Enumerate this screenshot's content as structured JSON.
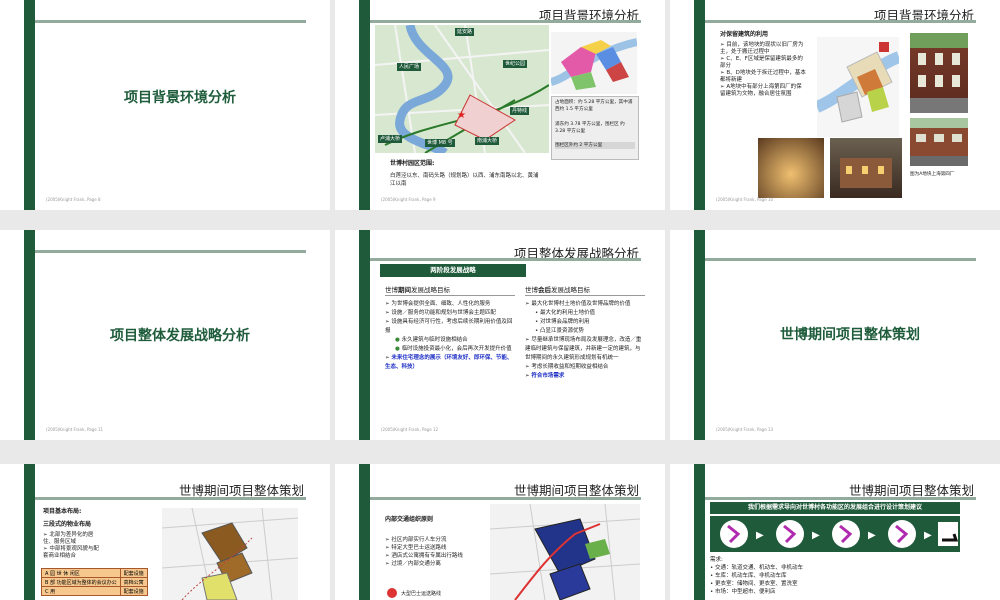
{
  "footer": "(2005)Knight Frank, Page",
  "slide1": {
    "title": "项目背景环境分析",
    "footer": "(2005)Knight Frank, Page 8"
  },
  "slide2": {
    "title": "项目背景环境分析",
    "map_labels": [
      "延安路",
      "人民广场",
      "世纪公园",
      "卢浦大桥",
      "世博 M8 号",
      "南浦大桥",
      "丹特线"
    ],
    "info_lines": [
      "占地面积：约 5.28 平方公里，其中浦西约 1.5 平方公里",
      "浦东约 3.78 平方公里，围栏区 约 3.28 平方公里",
      "围栏区外约 2 平方公里"
    ],
    "caption_title": "世博村园区范围:",
    "caption_text": "白莲泾以东、南码头路（规划路）以西、浦东南路以北、黄浦江以南",
    "footer": "(2005)Knight Frank, Page 9"
  },
  "slide3": {
    "title": "项目背景环境分析",
    "heading": "对保留建筑的利用",
    "bullets": [
      "目前，该地块的现状以旧厂房为主，处于搬迁过程中",
      "C、E、F区域是保留建筑最多的部分",
      "B、D地块处于拆迁过程中，基本都将新建",
      "A地块中有部分上海第四厂的保留建筑为文物，融合居住氛围"
    ],
    "photo_caption": "图为A地块上海第四厂",
    "footer": "(2005)Knight Frank, Page 10"
  },
  "slide4": {
    "title": "项目整体发展战略分析",
    "footer": "(2005)Knight Frank, Page 11"
  },
  "slide5": {
    "title": "项目整体发展战略分析",
    "banner": "两阶段发展战略",
    "left_head_a": "世博",
    "left_head_b": "期间",
    "left_head_c": "发展战略目标",
    "left_bullets": [
      "为世博会提供全面、细致、人性化的服务",
      "设施／服务的功能和规划与世博会主题匹配",
      "设施具有经济可行性，考虑后续长期利用价值及回报"
    ],
    "left_sub": [
      "永久建筑与临时设施相结合",
      "临时设施投资最小化，会后再次开发提升价值"
    ],
    "left_last": "未来住宅理念的展示（环境友好、即环保、节能、生态、科技）",
    "right_head_a": "世博",
    "right_head_b": "会后",
    "right_head_c": "发展战略目标",
    "right_bullet1": "最大化世博村土地价值及世博品牌的价值",
    "right_sub": [
      "最大化的利用土地价值",
      "对世博会品牌的利用",
      "凸显江景资源优势"
    ],
    "right_bullets": [
      "尽量继承世博现场布局及发展理念，改造／重建临时建筑与保留建筑，并新建一定的建筑，与世博期间的永久建筑形成规划有机统一",
      "考虑长期收益和短期收益相结合",
      "符合市场需求"
    ],
    "footer": "(2005)Knight Frank, Page 12"
  },
  "slide6": {
    "title": "世博期间项目整体策划",
    "footer": "(2005)Knight Frank, Page 13"
  },
  "slide7": {
    "title": "世博期间项目整体策划",
    "heading1": "项目基本布局:",
    "heading2": "三段式的物业布局",
    "bullets": [
      "北部为差异化的居住、服务区域",
      "中部将景观风貌与配套商业相结合"
    ],
    "table": [
      [
        "A 园 世 休 闲区",
        "配套设施"
      ],
      [
        "B 部 功能区域为整体的会议办公",
        "高档公寓"
      ],
      [
        "C 用 ",
        "配套设施"
      ]
    ]
  },
  "slide8": {
    "title": "世博期间项目整体策划",
    "heading": "内部交通组织原则",
    "bullets": [
      "社区内部实行人车分流",
      "特定大型巴士运送路线",
      "酒店式公寓拥有专属出行路线",
      "过境／内部交通分离"
    ],
    "legend": "大型巴士运送路线"
  },
  "slide9": {
    "title": "世博期间项目整体策划",
    "banner": "我们根据需求导向对世博村各功能区的发展组合进行设计策划建议",
    "needs_label": "需求:",
    "needs": [
      "交通：轨道交通、机动车、非机动车",
      "车库：机动车库、非机动车库",
      "更衣室：储物间、更衣室、置洗室",
      "市场：中型超市、便利店"
    ]
  }
}
